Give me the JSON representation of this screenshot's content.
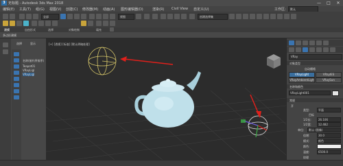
{
  "title_bar": {
    "logo": "3",
    "title": "无标题 - Autodesk 3ds Max 2018",
    "minimize": "—",
    "maximize": "□",
    "close": "✕"
  },
  "menu": {
    "items": [
      "编辑(E)",
      "工具(T)",
      "组(G)",
      "视图(V)",
      "创建(C)",
      "修改器(M)",
      "动画(A)",
      "图形编辑器(D)",
      "渲染(R)",
      "Civil View",
      "自定义(U)"
    ]
  },
  "toolbar": {
    "workspace_label": "工作区:",
    "workspace_value": "默认",
    "selection_filter": "全部",
    "view_dropdown": "视图",
    "named_selection": "创建选择集"
  },
  "ribbon": {
    "tabs": [
      "建模",
      "自由形式",
      "选择",
      "对象绘制",
      "填充"
    ],
    "sub_label": "多边形建模"
  },
  "explorer": {
    "tabs": [
      "选择",
      "显示"
    ],
    "header": "名称(按升序排序)",
    "rows": [
      "Teapot01",
      "VRayLigl",
      "VRayLigl"
    ]
  },
  "viewport": {
    "label": "[+] [透视] [标准] [默认明暗处理]"
  },
  "right_panel": {
    "category_dropdown": "VRay",
    "object_type_header": "对象类型",
    "auto_grid": "自动栅格",
    "buttons": [
      "VRayLight",
      "VRayIES",
      "VRayAmbientLight",
      "VRaySun"
    ],
    "name_color_header": "名称和颜色",
    "name_value": "VRayLight001",
    "general_header": "常规",
    "on_label": "开",
    "type_label": "类型:",
    "type_value": "平面",
    "target_label": "目标",
    "length_label": "1/2长:",
    "length_value": "26.106",
    "width_label": "1/2宽:",
    "width_value": "12.482",
    "units_label": "单位:",
    "units_value": "默认 (图像)",
    "multiplier_label": "倍增:",
    "multiplier_value": "30.0",
    "mode_label": "模式:",
    "mode_value": "颜色",
    "color_label": "颜色:",
    "temp_label": "温度:",
    "temp_value": "6500.0",
    "texture_label": "纹理"
  },
  "colors": {
    "accent": "#3a74b0",
    "teapot": "#bfe0ea",
    "light_gizmo": "#d8c86a",
    "arrow": "#e0201b"
  }
}
